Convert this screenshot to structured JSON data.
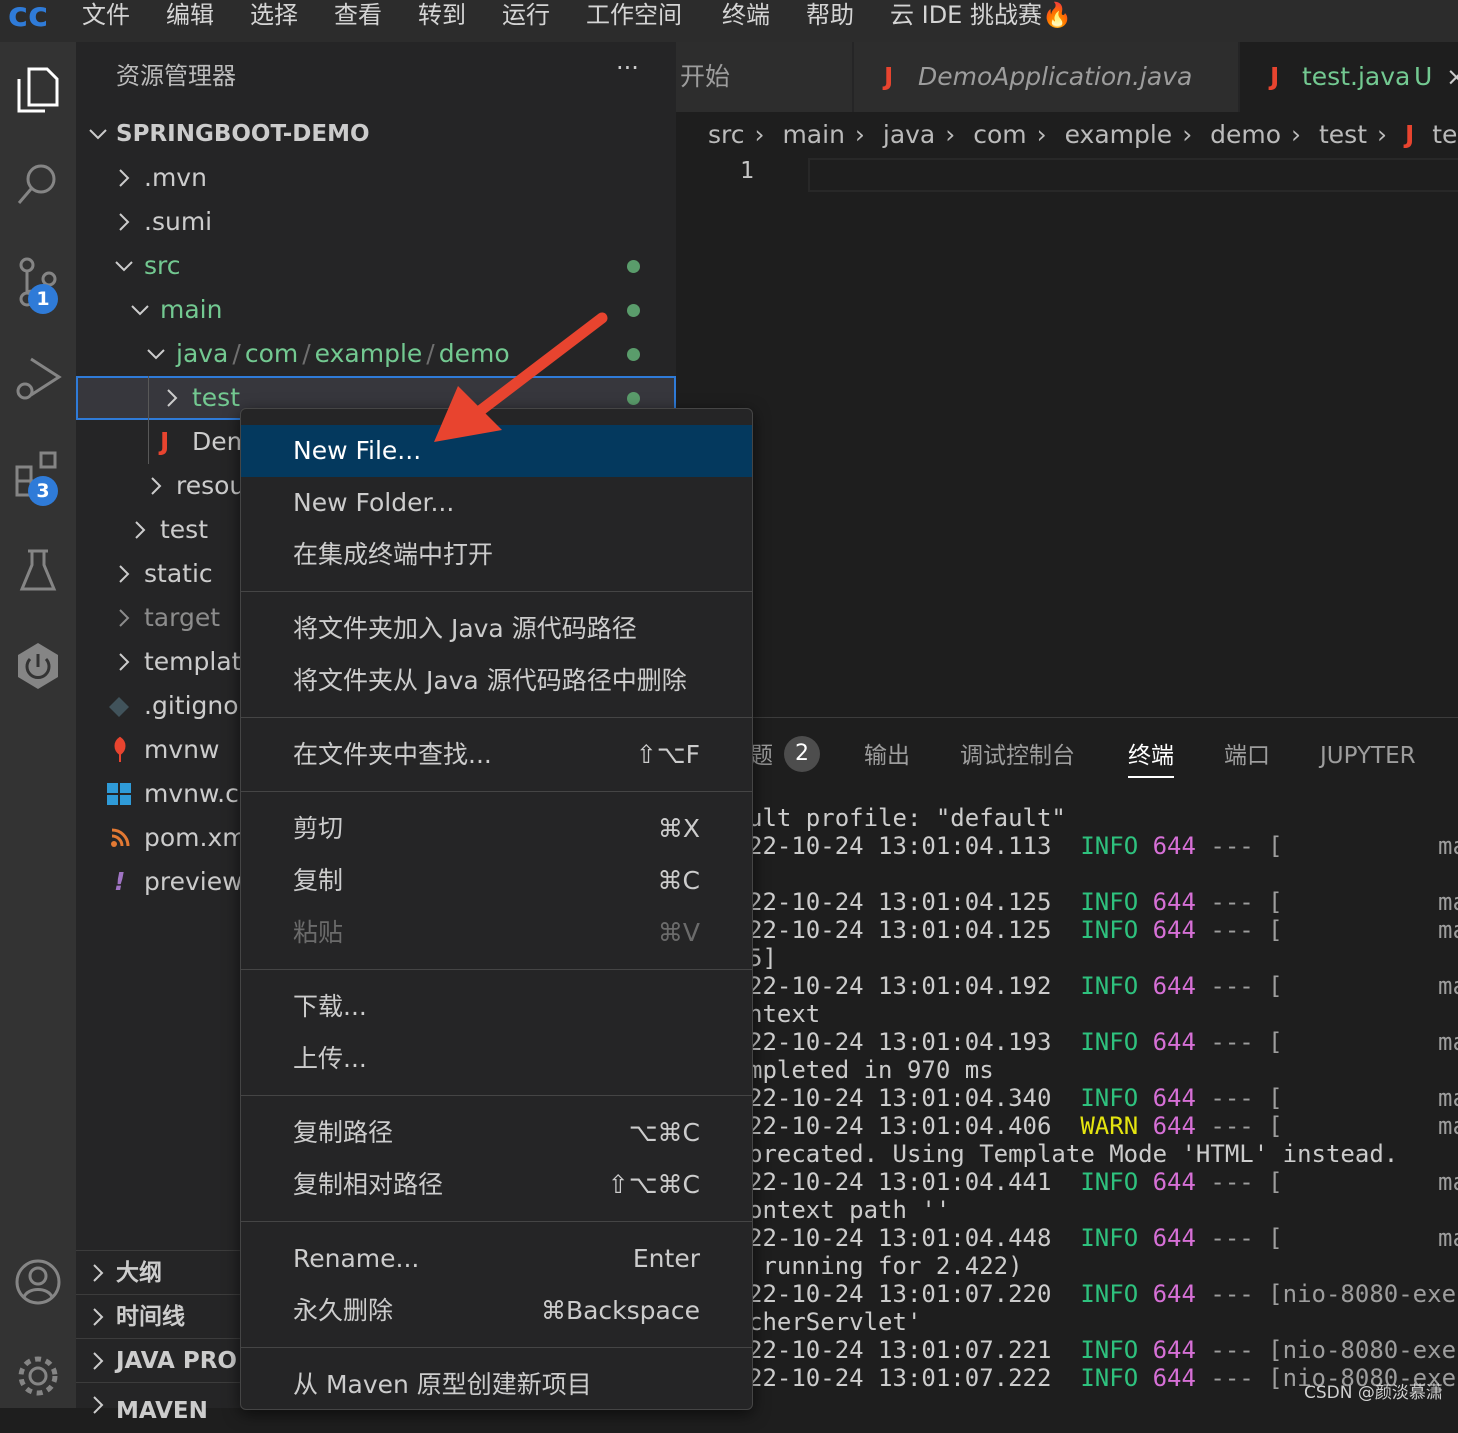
{
  "menubar": {
    "items": [
      "文件",
      "编辑",
      "选择",
      "查看",
      "转到",
      "运行",
      "工作空间",
      "终端",
      "帮助",
      "云 IDE 挑战赛🔥"
    ]
  },
  "activity": {
    "scm_badge": "1",
    "extensions_badge": "3"
  },
  "sidebar": {
    "title": "资源管理器",
    "more": "···",
    "project": "SPRINGBOOT-DEMO",
    "tree": {
      "mvn": ".mvn",
      "sumi": ".sumi",
      "src": "src",
      "main": "main",
      "pkg_java": "java",
      "pkg_com": "com",
      "pkg_example": "example",
      "pkg_demo": "demo",
      "sep": "/",
      "test_folder": "test",
      "demo_file": "Dem",
      "resources": "resou",
      "test2": "test",
      "static": "static",
      "target": "target",
      "templates": "templat",
      "gitignore": ".gitignor",
      "mvnw": "mvnw",
      "mvnw_cmd": "mvnw.cr",
      "pom": "pom.xm",
      "preview": "preview."
    },
    "sections": [
      "大纲",
      "时间线",
      "JAVA PRO",
      "MAVEN"
    ]
  },
  "tabs": [
    {
      "label": "开始"
    },
    {
      "label": "DemoApplication.java"
    },
    {
      "label": "test.java",
      "status": "U"
    }
  ],
  "breadcrumbs": [
    "src",
    "main",
    "java",
    "com",
    "example",
    "demo",
    "test",
    "test.ja"
  ],
  "editor": {
    "line_number": "1"
  },
  "panel": {
    "tabs": [
      "题",
      "输出",
      "调试控制台",
      "终端",
      "端口",
      "JUPYTER"
    ],
    "problems_count": "2",
    "active_tab": "终端",
    "lines": [
      {
        "text": "ult profile: \"default\""
      },
      {
        "date": "22-10-24 13:01:04.113",
        "level": "INFO",
        "pid": "644",
        "rest": "--- [",
        "tail": "ma"
      },
      {
        "date": "22-10-24 13:01:04.125",
        "level": "INFO",
        "pid": "644",
        "rest": "--- [",
        "tail": "ma"
      },
      {
        "date": "22-10-24 13:01:04.125",
        "level": "INFO",
        "pid": "644",
        "rest": "--- [",
        "tail": "ma"
      },
      {
        "text": "5]"
      },
      {
        "date": "22-10-24 13:01:04.192",
        "level": "INFO",
        "pid": "644",
        "rest": "--- [",
        "tail": "ma"
      },
      {
        "text": "ntext"
      },
      {
        "date": "22-10-24 13:01:04.193",
        "level": "INFO",
        "pid": "644",
        "rest": "--- [",
        "tail": "ma"
      },
      {
        "text": "mpleted in 970 ms"
      },
      {
        "date": "22-10-24 13:01:04.340",
        "level": "INFO",
        "pid": "644",
        "rest": "--- [",
        "tail": "ma"
      },
      {
        "date": "22-10-24 13:01:04.406",
        "level": "WARN",
        "pid": "644",
        "rest": "--- [",
        "tail": "ma"
      },
      {
        "text": "precated. Using Template Mode 'HTML' instead."
      },
      {
        "date": "22-10-24 13:01:04.441",
        "level": "INFO",
        "pid": "644",
        "rest": "--- [",
        "tail": "ma"
      },
      {
        "text": "ontext path ''"
      },
      {
        "date": "22-10-24 13:01:04.448",
        "level": "INFO",
        "pid": "644",
        "rest": "--- [",
        "tail": "ma"
      },
      {
        "text": " running for 2.422)"
      },
      {
        "date": "22-10-24 13:01:07.220",
        "level": "INFO",
        "pid": "644",
        "rest": "--- [nio-8080-exec",
        "tail": ""
      },
      {
        "text": "cherServlet'"
      },
      {
        "date": "22-10-24 13:01:07.221",
        "level": "INFO",
        "pid": "644",
        "rest": "--- [nio-8080-exec",
        "tail": ""
      },
      {
        "date": "22-10-24 13:01:07.222",
        "level": "INFO",
        "pid": "644",
        "rest": "--- [nio-8080-exec",
        "tail": ""
      }
    ]
  },
  "context_menu": {
    "new_file": "New File...",
    "new_folder": "New Folder...",
    "open_terminal": "在集成终端中打开",
    "add_java_src": "将文件夹加入 Java 源代码路径",
    "remove_java_src": "将文件夹从 Java 源代码路径中删除",
    "find_in_folder": "在文件夹中查找...",
    "find_in_folder_key": "⇧⌥F",
    "cut": "剪切",
    "cut_key": "⌘X",
    "copy": "复制",
    "copy_key": "⌘C",
    "paste": "粘贴",
    "paste_key": "⌘V",
    "download": "下载...",
    "upload": "上传...",
    "copy_path": "复制路径",
    "copy_path_key": "⌥⌘C",
    "copy_rel_path": "复制相对路径",
    "copy_rel_path_key": "⇧⌥⌘C",
    "rename": "Rename...",
    "rename_key": "Enter",
    "delete": "永久删除",
    "delete_key": "⌘Backspace",
    "maven_archetype": "从 Maven 原型创建新项目"
  },
  "watermark": "CSDN @颜淡慕潇",
  "colors": {
    "accent_red": "#e8442f",
    "selection": "#04395e",
    "git_green": "#73c991",
    "info_green": "#2ec27e",
    "warn_yellow": "#e5e510",
    "pid_magenta": "#d670d6",
    "badge_blue": "#2f7bd8"
  }
}
